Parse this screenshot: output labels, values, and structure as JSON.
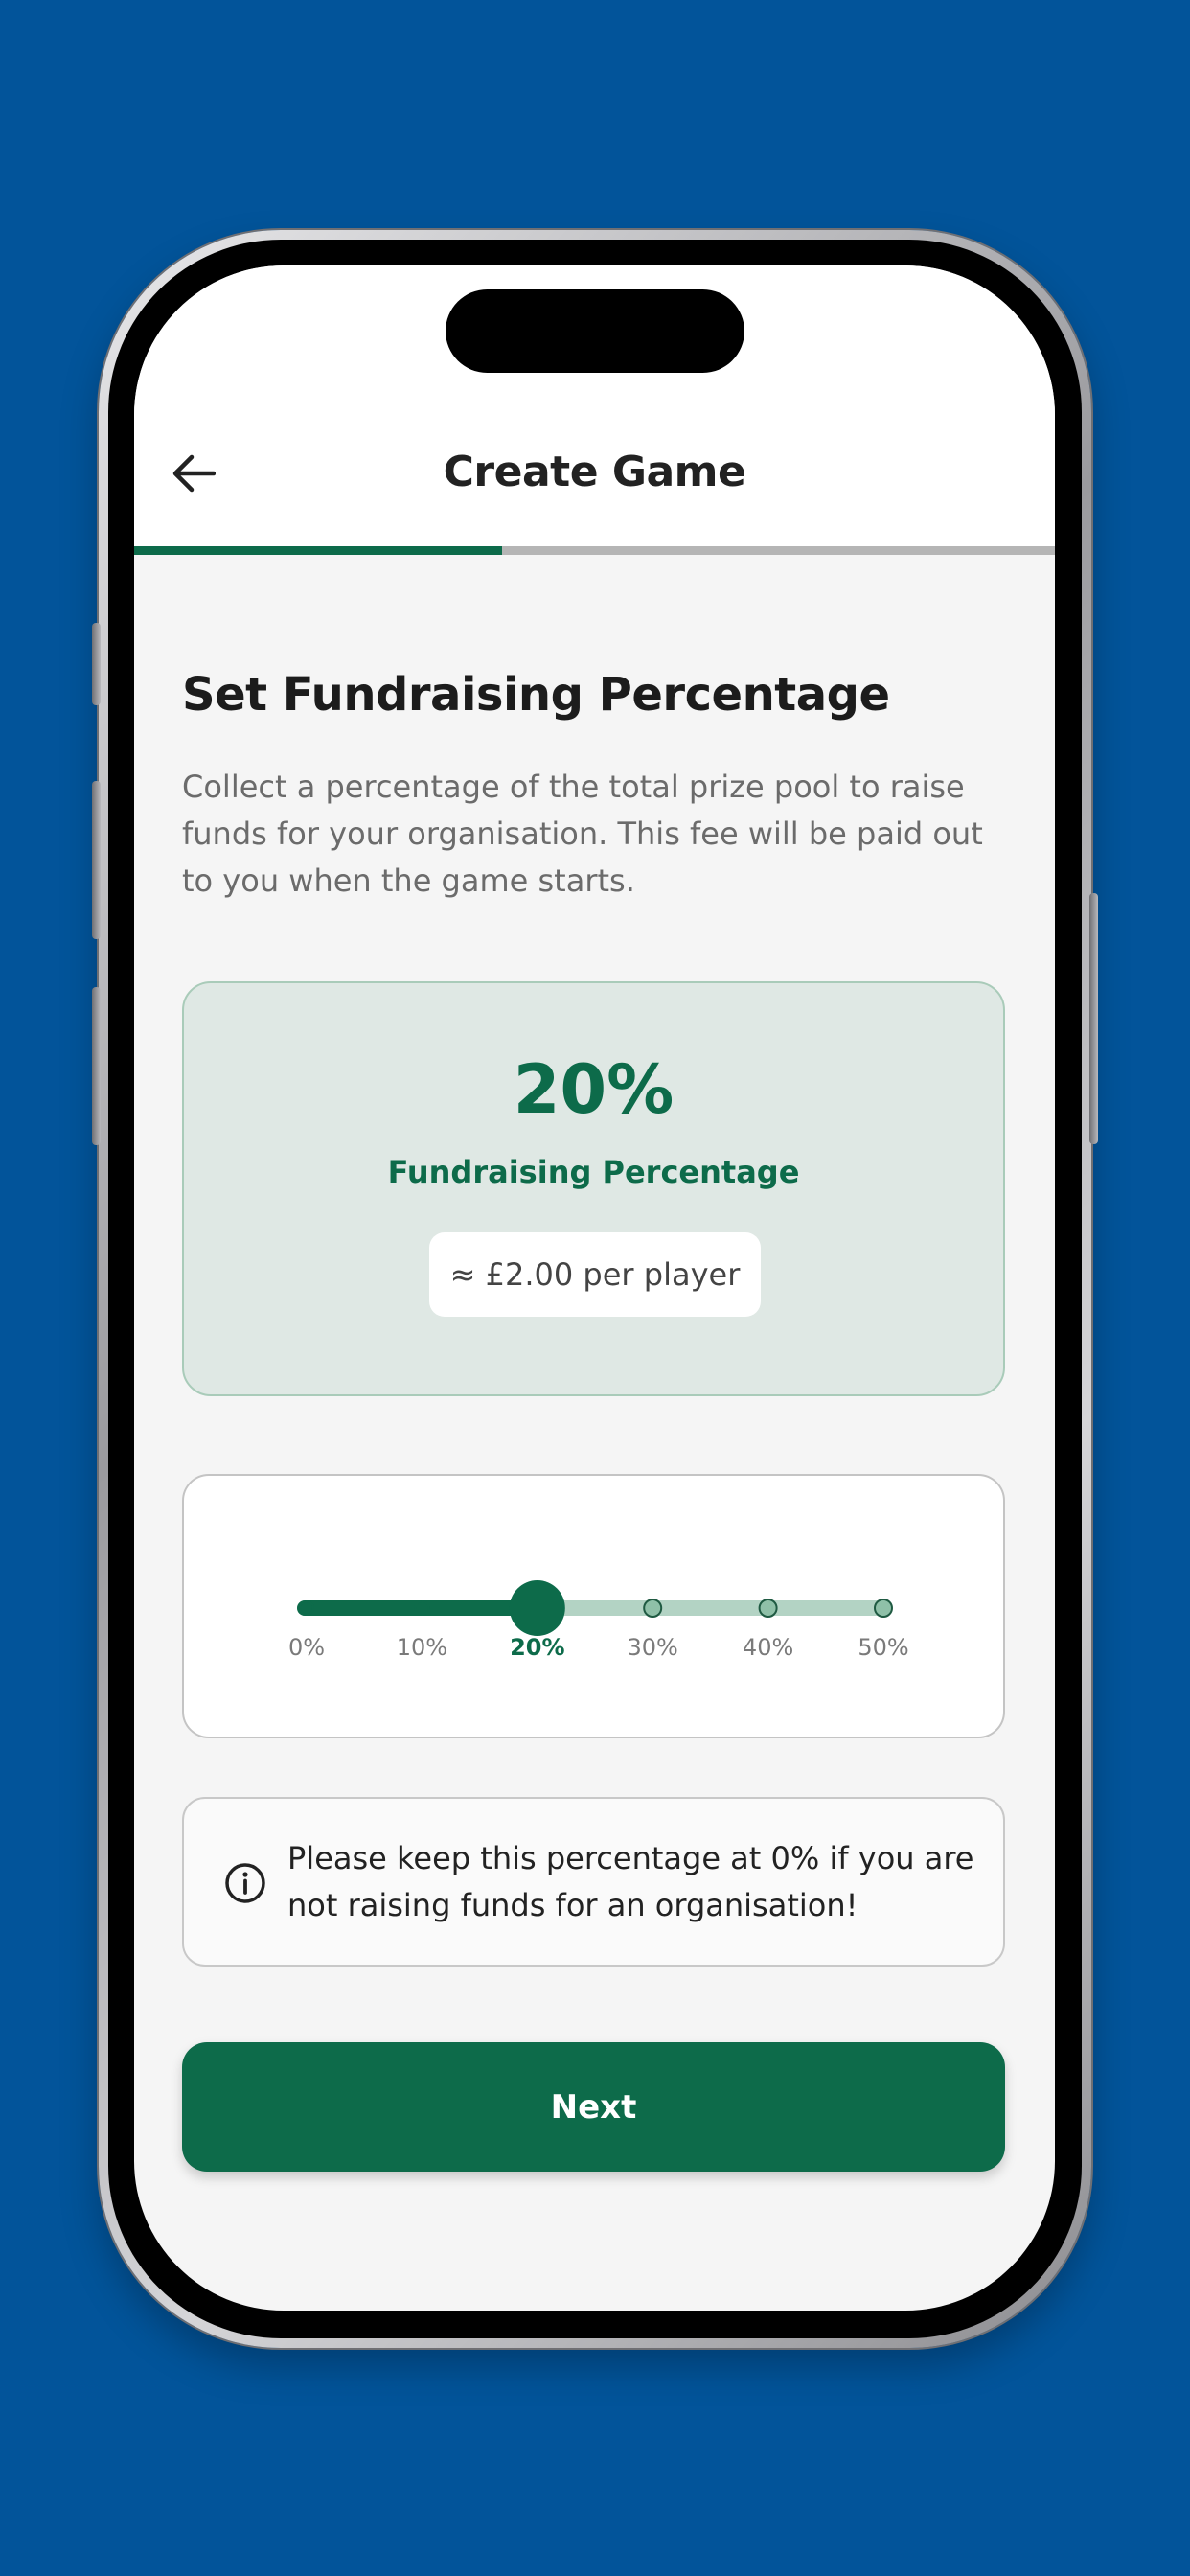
{
  "header": {
    "title": "Create Game",
    "back_icon": "arrow-left-icon",
    "step_progress": 0.4
  },
  "section": {
    "title": "Set Fundraising Percentage",
    "description": "Collect a percentage of the total prize pool to raise funds for your organisation. This fee will be paid out to you when the game starts."
  },
  "summary": {
    "value": "20%",
    "label": "Fundraising Percentage",
    "per_player": "≈ £2.00 per player"
  },
  "slider": {
    "value": 20,
    "min": 0,
    "max": 50,
    "ticks": [
      {
        "label": "0%",
        "value": 0
      },
      {
        "label": "10%",
        "value": 10
      },
      {
        "label": "20%",
        "value": 20
      },
      {
        "label": "30%",
        "value": 30
      },
      {
        "label": "40%",
        "value": 40
      },
      {
        "label": "50%",
        "value": 50
      }
    ]
  },
  "notice": {
    "icon": "info-icon",
    "text": "Please keep this percentage at 0% if you are not raising funds for an organisation!"
  },
  "actions": {
    "next_label": "Next"
  },
  "colors": {
    "background": "#02549a",
    "accent": "#0d6b4a",
    "accent_light": "#b3d3c4",
    "card_tint": "#dfe8e4"
  }
}
